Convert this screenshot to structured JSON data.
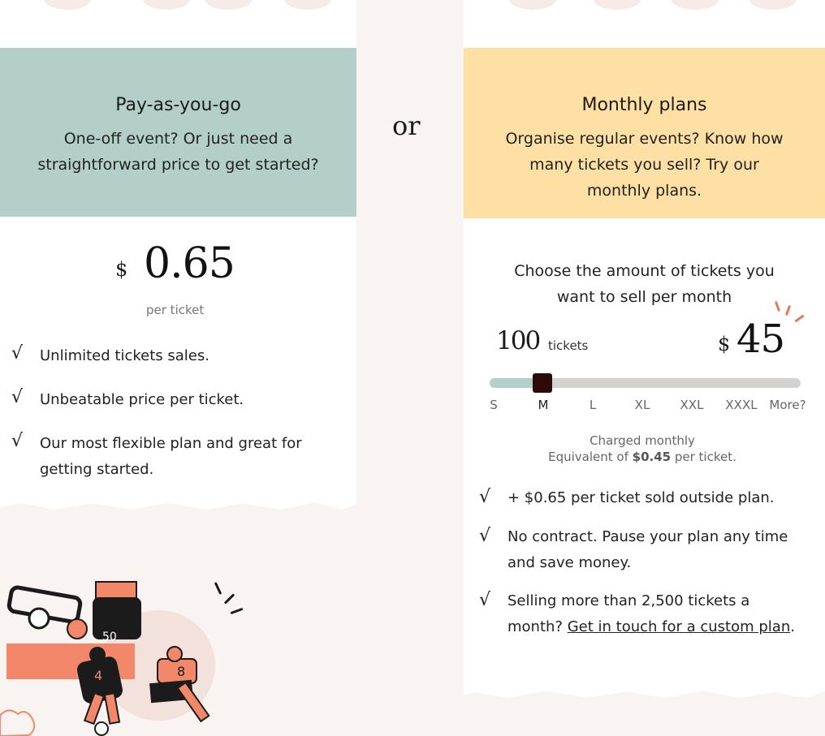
{
  "pay_as_you_go": {
    "title": "Pay-as-you-go",
    "subtitle_line1": "One-off event? Or just need a",
    "subtitle_line2": "straightforward price to get started?",
    "currency": "$",
    "price": "0.65",
    "unit": "per ticket",
    "features": [
      "Unlimited tickets sales.",
      "Unbeatable price per ticket.",
      "Our most flexible plan and great for",
      "getting started."
    ],
    "check_mark": "√"
  },
  "separator": "or",
  "monthly": {
    "title": "Monthly plans",
    "subtitle_line1": "Organise regular events? Know how",
    "subtitle_line2": "many tickets you sell? Try our",
    "subtitle_line3": "monthly plans.",
    "choose_line1": "Choose the amount of tickets you",
    "choose_line2": "want to sell per month",
    "ticket_count": "100",
    "ticket_word": "tickets",
    "currency": "$",
    "price": "45",
    "slider": {
      "selected": "M",
      "selected_fraction": 0.17,
      "sizes": [
        "S",
        "M",
        "L",
        "XL",
        "XXL",
        "XXXL",
        "More?"
      ]
    },
    "charged": "Charged monthly",
    "equiv_prefix": "Equivalent of ",
    "equiv_value": "$0.45",
    "equiv_suffix": " per ticket.",
    "features": {
      "f1": "+ $0.65 per ticket sold outside plan.",
      "f2_line1": "No contract. Pause your plan any time",
      "f2_line2": "and save money.",
      "f3_line1": "Selling more than 2,500 tickets a",
      "f3_prefix": "month? ",
      "f3_link": "Get in touch for a custom plan",
      "f3_suffix": "."
    }
  },
  "illustration": {
    "jersey_numbers": [
      "50",
      "4",
      "8"
    ]
  },
  "colors": {
    "teal": "#b4cfc9",
    "yellow": "#fedfa4",
    "salmon": "#f2876a",
    "ink": "#1b1b1b"
  }
}
